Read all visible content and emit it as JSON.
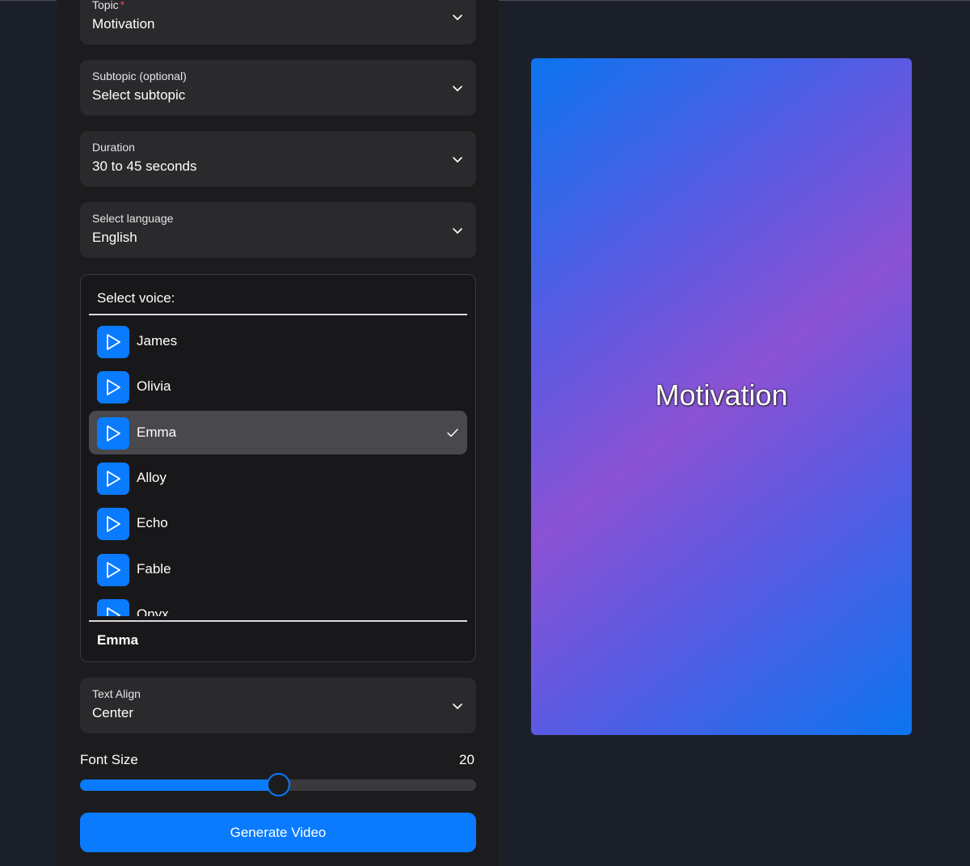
{
  "form": {
    "topic": {
      "label": "Topic",
      "required_mark": "*",
      "value": "Motivation"
    },
    "subtopic": {
      "label": "Subtopic (optional)",
      "value": "Select subtopic"
    },
    "duration": {
      "label": "Duration",
      "value": "30 to 45 seconds"
    },
    "language": {
      "label": "Select language",
      "value": "English"
    },
    "text_align": {
      "label": "Text Align",
      "value": "Center"
    },
    "font_size": {
      "label": "Font Size",
      "value": "20",
      "level_percent": 50
    },
    "generate_label": "Generate Video"
  },
  "voice": {
    "heading": "Select voice:",
    "items": [
      {
        "name": "James",
        "selected": false
      },
      {
        "name": "Olivia",
        "selected": false
      },
      {
        "name": "Emma",
        "selected": true
      },
      {
        "name": "Alloy",
        "selected": false
      },
      {
        "name": "Echo",
        "selected": false
      },
      {
        "name": "Fable",
        "selected": false
      },
      {
        "name": "Onyx",
        "selected": false
      }
    ],
    "selected_value": "Emma"
  },
  "preview": {
    "text": "Motivation"
  },
  "colors": {
    "accent": "#0a7bff",
    "background": "#1b1f2a",
    "panel": "#1c1c1e",
    "field": "#2a2a2d",
    "gradient_edge": "#0c74ee",
    "gradient_mid": "#8b52d4"
  }
}
